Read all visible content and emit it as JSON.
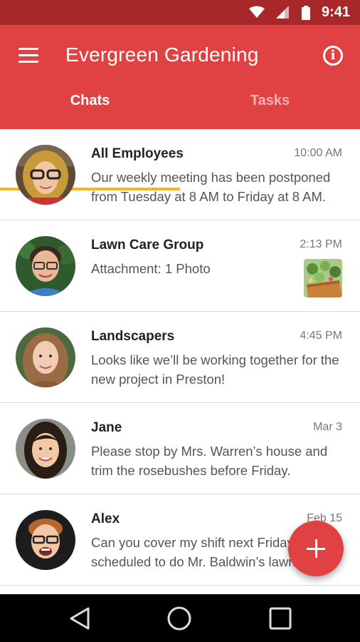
{
  "status_bar": {
    "time": "9:41"
  },
  "app_bar": {
    "title": "Evergreen Gardening"
  },
  "tabs": [
    {
      "label": "Chats",
      "active": true
    },
    {
      "label": "Tasks",
      "active": false
    }
  ],
  "chats": [
    {
      "name": "All Employees",
      "time": "10:00 AM",
      "preview": "Our weekly meeting has been postponed from Tuesday at 8 AM to Friday at 8 AM."
    },
    {
      "name": "Lawn Care Group",
      "time": "2:13 PM",
      "preview": "Attachment: 1 Photo"
    },
    {
      "name": "Landscapers",
      "time": "4:45 PM",
      "preview": "Looks like we’ll be working together for the new project in Preston!"
    },
    {
      "name": "Jane",
      "time": "Mar 3",
      "preview": "Please stop  by Mrs. Warren’s house and trim the rosebushes before Friday."
    },
    {
      "name": "Alex",
      "time": "Feb 15",
      "preview": "Can you cover my shift next Friday? I’m scheduled to do Mr. Baldwin’s lawn."
    }
  ],
  "colors": {
    "primary": "#e04243",
    "status_bar": "#a8272a",
    "tab_indicator": "#f8b427"
  },
  "icons": {
    "menu": "menu-icon",
    "info": "info-icon",
    "fab": "add-icon"
  }
}
